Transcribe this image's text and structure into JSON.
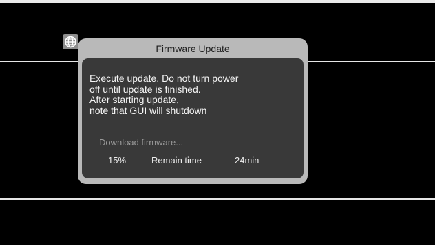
{
  "dialog": {
    "title": "Firmware Update",
    "message_lines": [
      "Execute update. Do not turn power",
      "off until update is finished.",
      "After starting update,",
      "note that GUI will shutdown"
    ],
    "status": "Download firmware...",
    "progress_percent_text": "15%",
    "progress_fraction": 0.15,
    "remain_label": "Remain time",
    "remain_value": "24min"
  },
  "icons": {
    "network": "globe-icon"
  },
  "colors": {
    "background": "#000000",
    "dialog_frame": "#b9b9b9",
    "dialog_body": "#393939",
    "text_primary": "#f4f4f4",
    "text_secondary": "#9a9a9a"
  }
}
